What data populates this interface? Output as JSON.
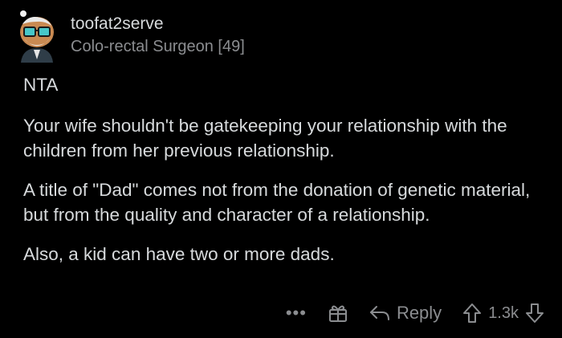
{
  "comment": {
    "author": "toofat2serve",
    "flair": "Colo-rectal Surgeon [49]",
    "paragraphs": [
      "NTA",
      "Your wife shouldn't be gatekeeping your relationship with the children from her previous relationship.",
      "A title of \"Dad\" comes not from the donation of genetic material, but from the quality and character of a relationship.",
      "Also, a kid can have two or more dads."
    ]
  },
  "actions": {
    "more_label": "•••",
    "reply_label": "Reply",
    "score": "1.3k"
  },
  "icons": {
    "more": "more-icon",
    "award": "gift-award-icon",
    "reply": "reply-arrow-icon",
    "upvote": "upvote-arrow-icon",
    "downvote": "downvote-arrow-icon"
  },
  "colors": {
    "background": "#000000",
    "text": "#d7dadc",
    "muted": "#8b8d90"
  }
}
